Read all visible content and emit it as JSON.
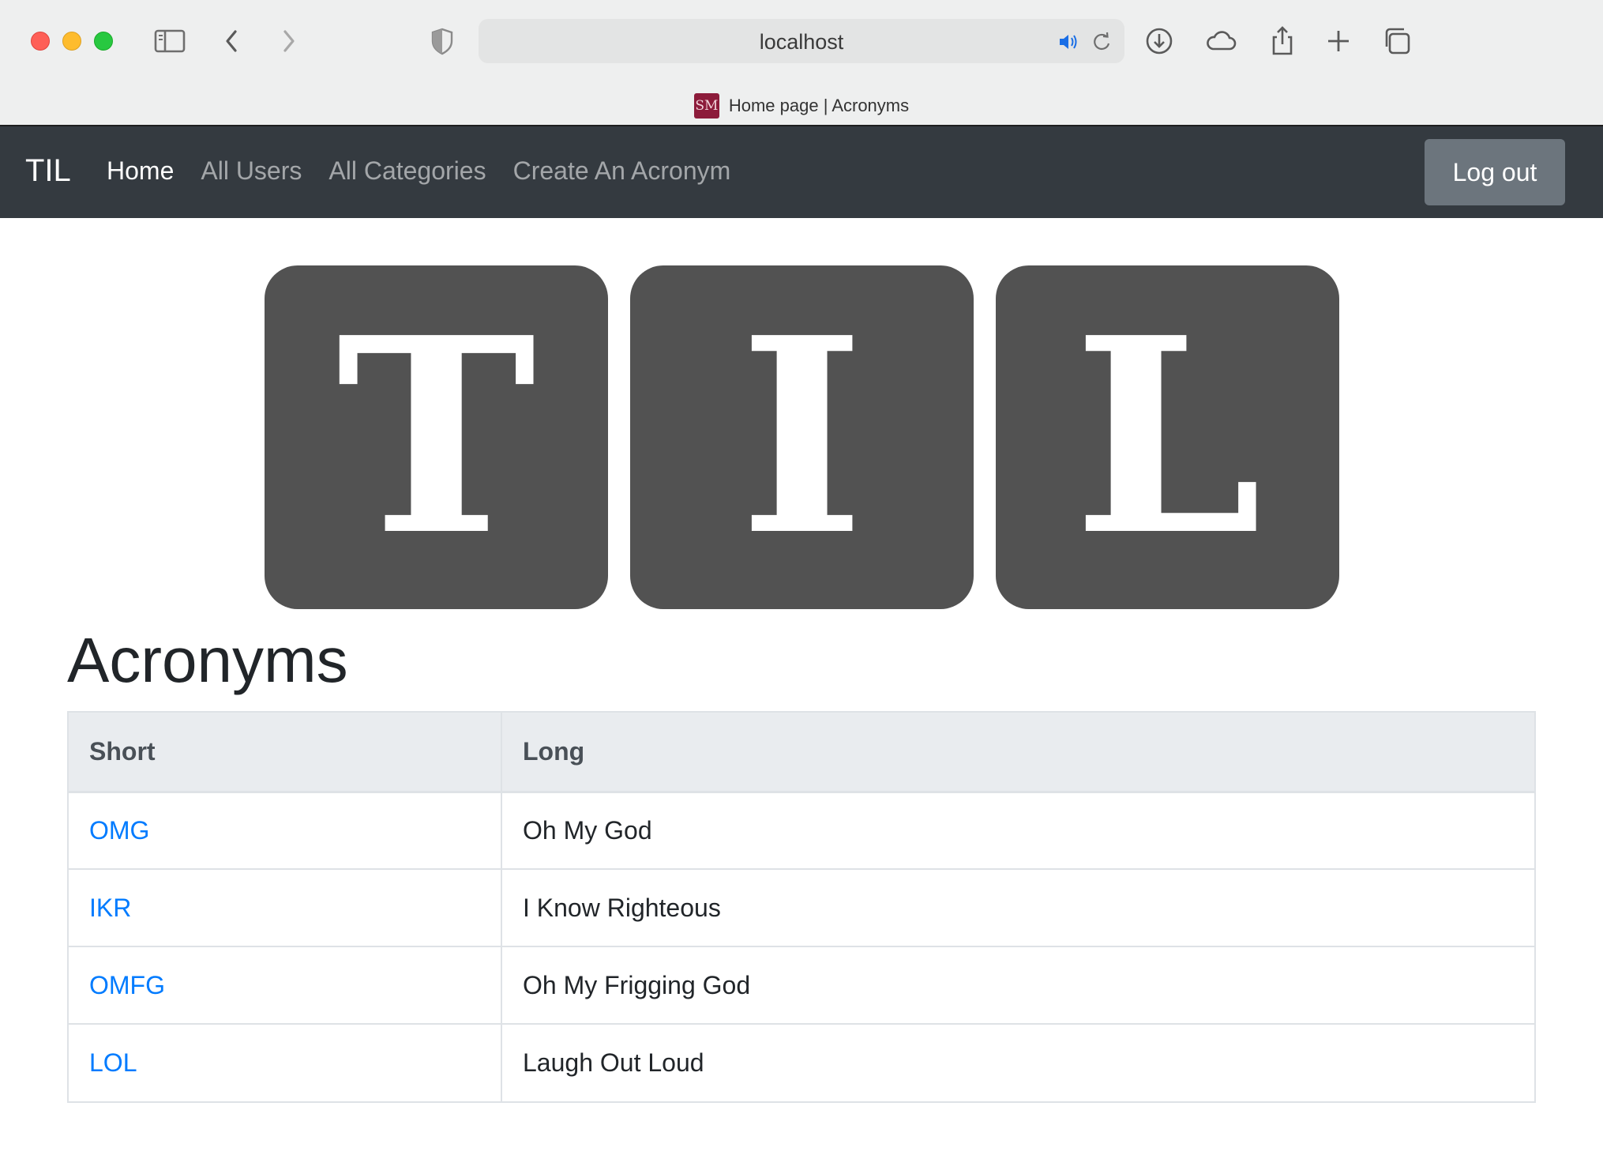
{
  "browser": {
    "address": "localhost",
    "tab_title": "Home page | Acronyms",
    "favicon_text": "SM",
    "icons": [
      "sidebar-icon",
      "back-icon",
      "forward-icon",
      "shield-icon",
      "speaker-icon",
      "reload-icon",
      "download-icon",
      "cloud-icon",
      "share-icon",
      "new-tab-icon",
      "tabs-overview-icon"
    ],
    "colors": {
      "close": "#fe5f57",
      "minimize": "#febc2e",
      "zoom": "#28c840"
    }
  },
  "navbar": {
    "brand": "TIL",
    "links": [
      {
        "label": "Home",
        "active": true
      },
      {
        "label": "All Users",
        "active": false
      },
      {
        "label": "All Categories",
        "active": false
      },
      {
        "label": "Create An Acronym",
        "active": false
      }
    ],
    "logout_label": "Log out",
    "colors": {
      "background": "#343a40",
      "logout": "#6c757d"
    }
  },
  "logo": {
    "letters": [
      "T",
      "I",
      "L"
    ],
    "tile_color": "#525252"
  },
  "main": {
    "title": "Acronyms",
    "table": {
      "headers": [
        "Short",
        "Long"
      ],
      "rows": [
        {
          "short": "OMG",
          "long": "Oh My God"
        },
        {
          "short": "IKR",
          "long": "I Know Righteous"
        },
        {
          "short": "OMFG",
          "long": "Oh My Frigging God"
        },
        {
          "short": "LOL",
          "long": "Laugh Out Loud"
        }
      ],
      "link_color": "#007bff"
    }
  }
}
